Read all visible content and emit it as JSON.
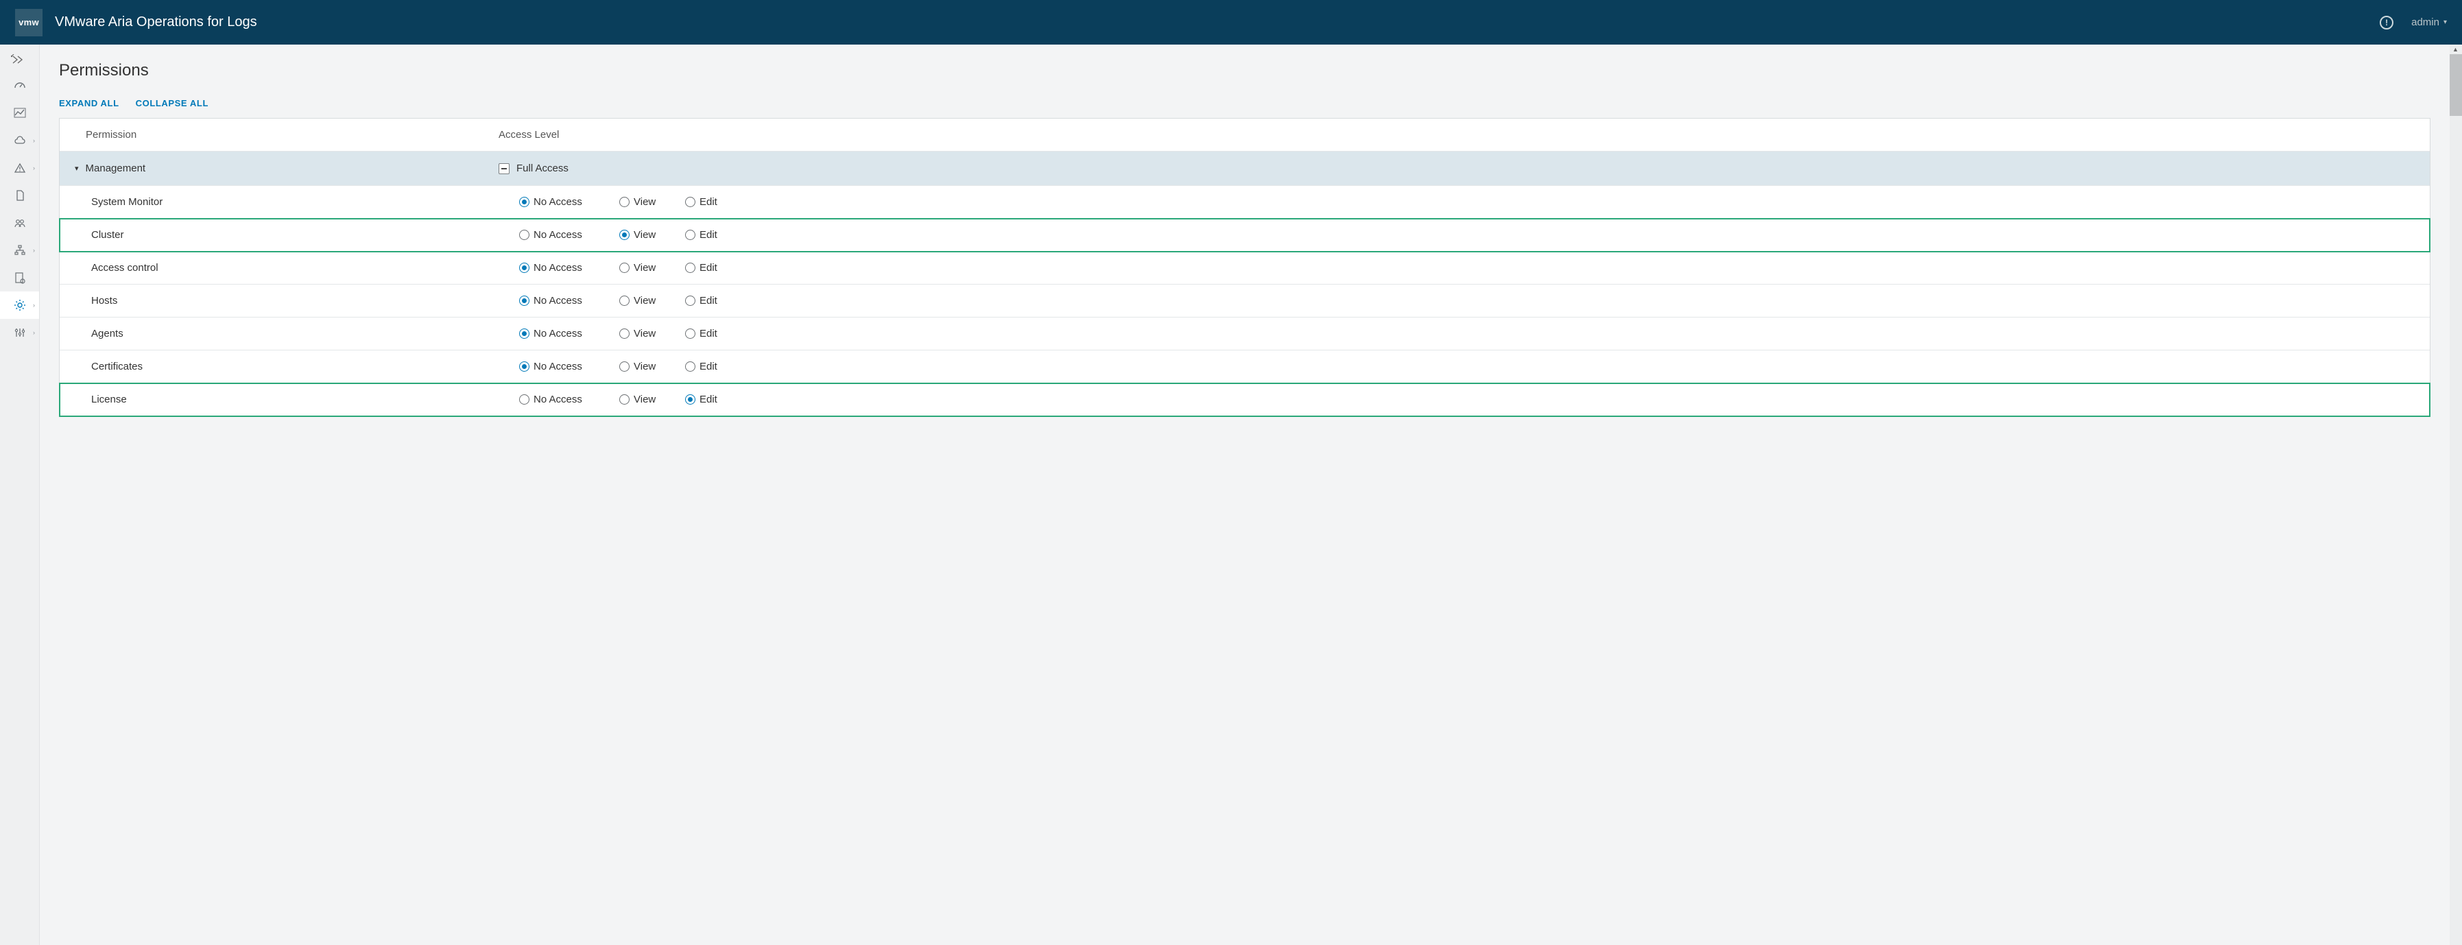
{
  "header": {
    "logo_text": "vmw",
    "product_title": "VMware Aria Operations for Logs",
    "user_label": "admin"
  },
  "page": {
    "title": "Permissions",
    "expand_all": "EXPAND ALL",
    "collapse_all": "COLLAPSE ALL"
  },
  "table": {
    "col_permission": "Permission",
    "col_access": "Access Level",
    "group_label": "Management",
    "group_state_label": "Full Access",
    "option_labels": {
      "no_access": "No Access",
      "view": "View",
      "edit": "Edit"
    },
    "rows": [
      {
        "name": "System Monitor",
        "selected": "no_access",
        "highlight": false
      },
      {
        "name": "Cluster",
        "selected": "view",
        "highlight": true
      },
      {
        "name": "Access control",
        "selected": "no_access",
        "highlight": false
      },
      {
        "name": "Hosts",
        "selected": "no_access",
        "highlight": false
      },
      {
        "name": "Agents",
        "selected": "no_access",
        "highlight": false
      },
      {
        "name": "Certificates",
        "selected": "no_access",
        "highlight": false
      },
      {
        "name": "License",
        "selected": "edit",
        "highlight": true
      }
    ]
  }
}
